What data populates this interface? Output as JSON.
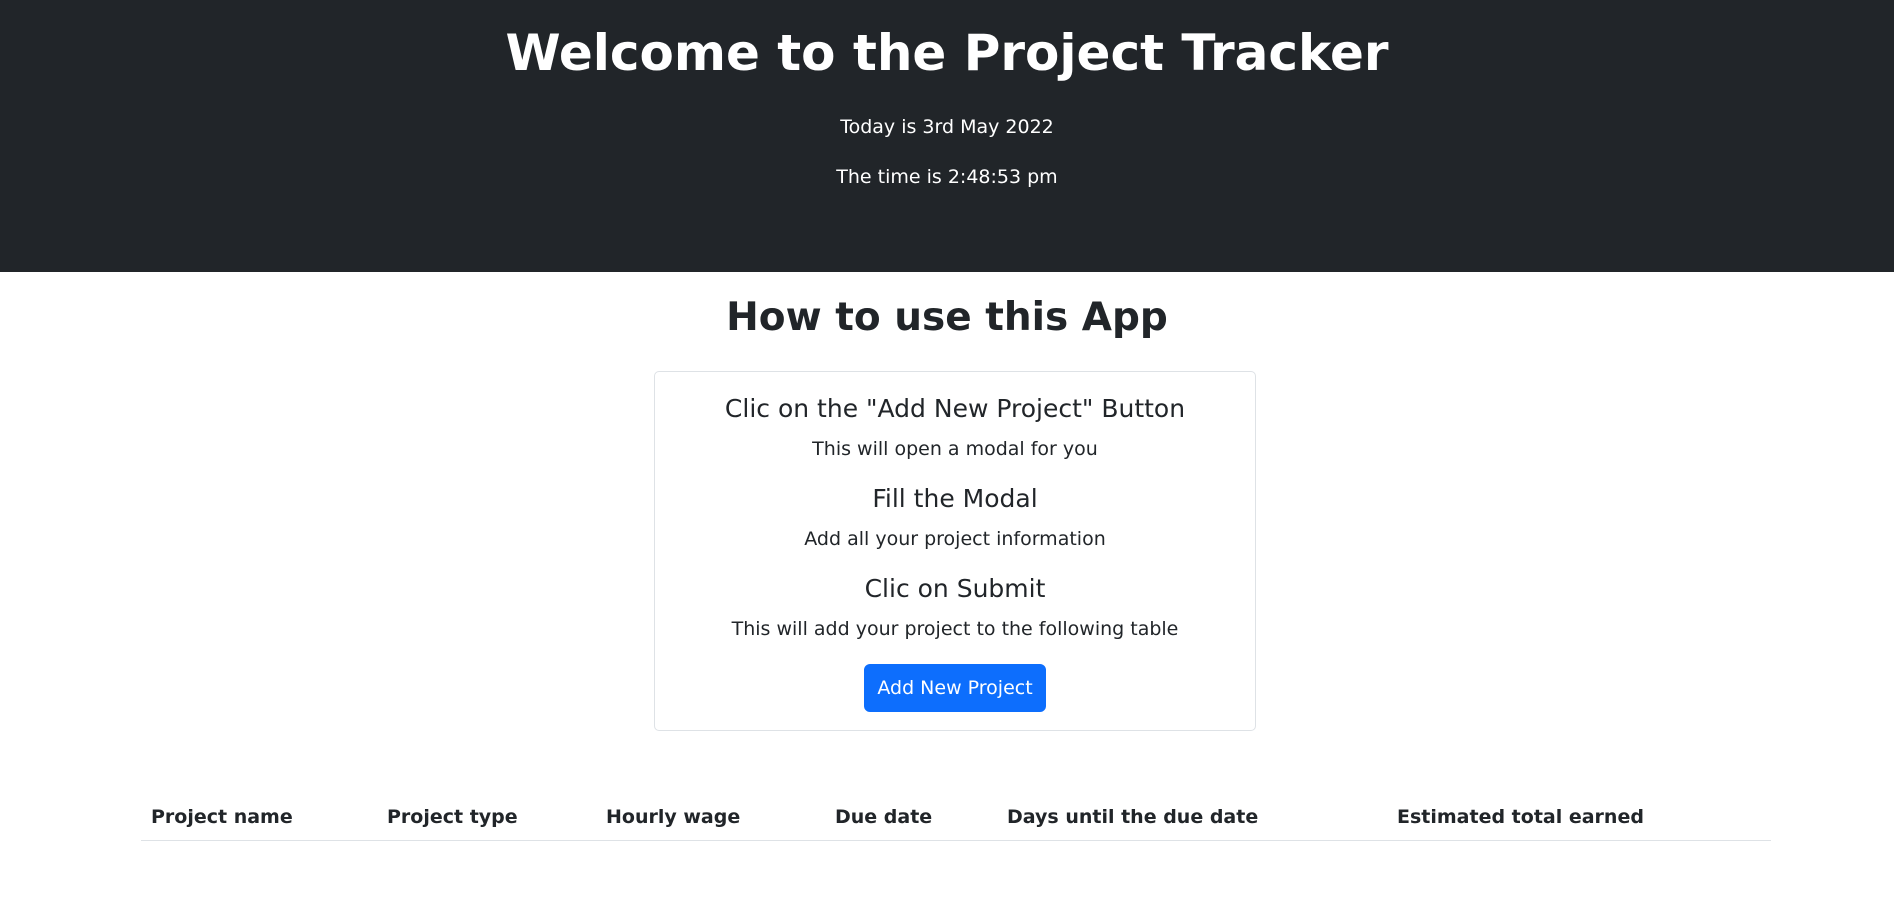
{
  "header": {
    "title": "Welcome to the Project Tracker",
    "date_text": "Today is 3rd May 2022",
    "time_text": "The time is 2:48:53 pm"
  },
  "instructions": {
    "title": "How to use this App",
    "steps": [
      {
        "title": "Clic on the \"Add New Project\" Button",
        "description": "This will open a modal for you"
      },
      {
        "title": "Fill the Modal",
        "description": "Add all your project information"
      },
      {
        "title": "Clic on Submit",
        "description": "This will add your project to the following table"
      }
    ],
    "button_label": "Add New Project"
  },
  "table": {
    "columns": [
      "Project name",
      "Project type",
      "Hourly wage",
      "Due date",
      "Days until the due date",
      "Estimated total earned"
    ],
    "rows": []
  },
  "colors": {
    "header_bg": "#212529",
    "primary_button": "#0d6efd"
  }
}
